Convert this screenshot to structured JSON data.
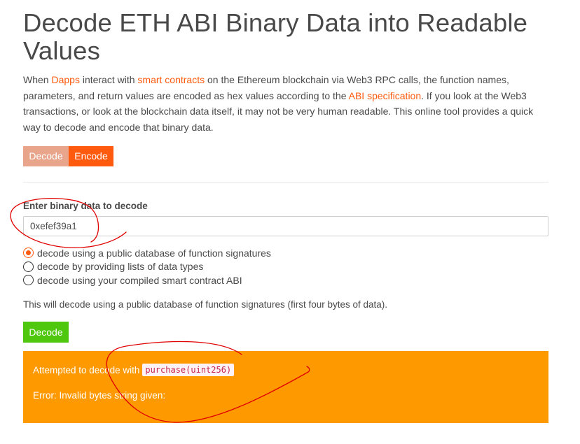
{
  "page": {
    "title": "Decode ETH ABI Binary Data into Readable Values"
  },
  "intro": {
    "t1": "When ",
    "link_dapps": "Dapps",
    "t2": " interact with ",
    "link_smart_contracts": "smart contracts",
    "t3": " on the Ethereum blockchain via Web3 RPC calls, the function names, parameters, and return values are encoded as hex values according to the ",
    "link_abi_spec": "ABI specification",
    "t4": ". If you look at the Web3 transactions, or look at the blockchain data itself, it may not be very human readable. This online tool provides a quick way to decode and encode that binary data."
  },
  "tabs": [
    {
      "label": "Decode",
      "active": true
    },
    {
      "label": "Encode",
      "active": false
    }
  ],
  "form": {
    "input_label": "Enter binary data to decode",
    "input_value": "0xefef39a1",
    "radio_options": [
      {
        "label": "decode using a public database of function signatures",
        "selected": true
      },
      {
        "label": "decode by providing lists of data types",
        "selected": false
      },
      {
        "label": "decode using your compiled smart contract ABI",
        "selected": false
      }
    ],
    "help_text": "This will decode using a public database of function signatures (first four bytes of data).",
    "decode_button": "Decode"
  },
  "result": {
    "attempt_prefix": "Attempted to decode with",
    "signature": "purchase(uint256)",
    "error": "Error: Invalid bytes string given:"
  },
  "colors": {
    "accent": "#ff5a0d",
    "tab_inactive": "#e8a58b",
    "success_button": "#4fc70f",
    "result_panel": "#ff9900",
    "annotation_ink": "#e00000"
  }
}
